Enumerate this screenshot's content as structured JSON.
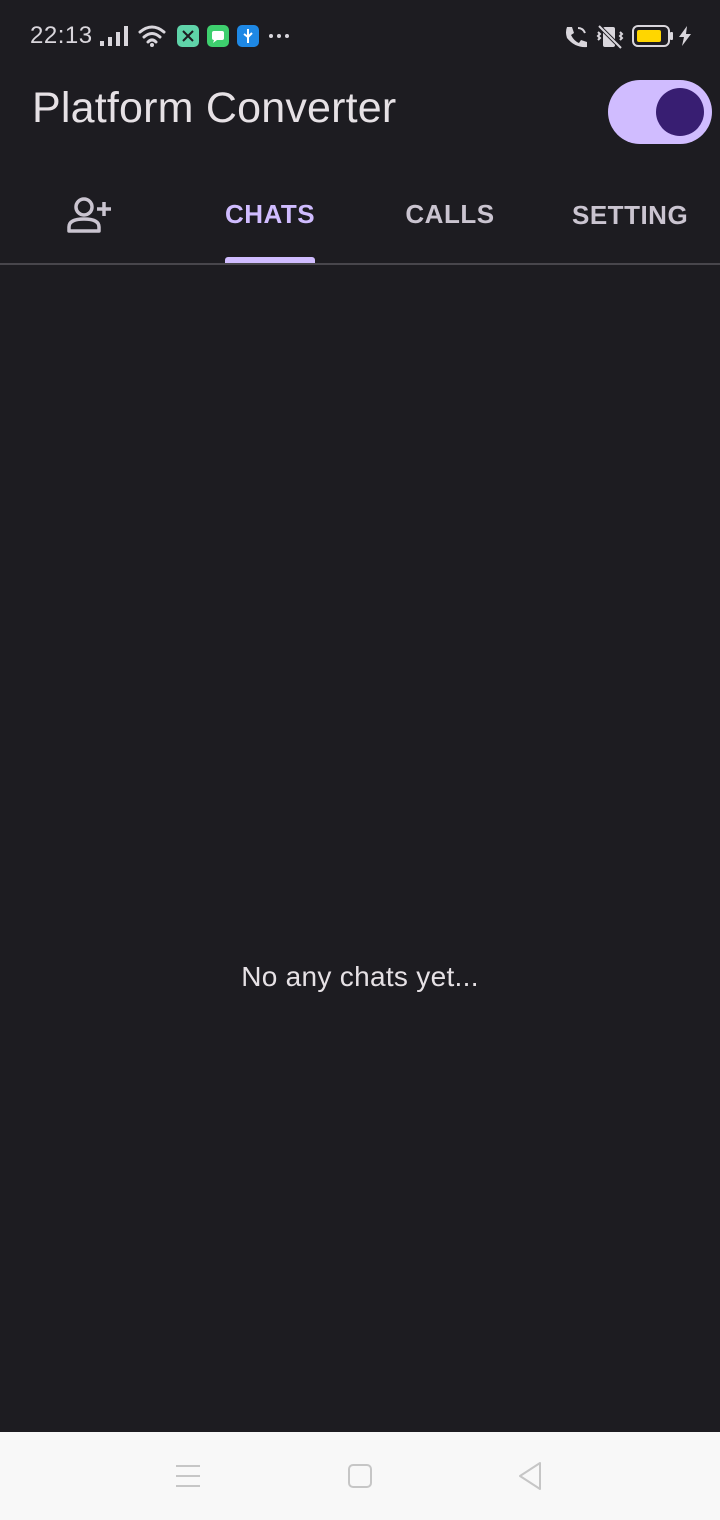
{
  "status_bar": {
    "time": "22:13",
    "icons": [
      "signal-icon",
      "wifi-icon",
      "app-notification-icon",
      "message-icon",
      "usb-icon",
      "more-icon",
      "wifi-calling-icon",
      "vibrate-icon",
      "battery-icon",
      "charging-icon"
    ],
    "battery_color": "#ffd600"
  },
  "app_bar": {
    "title": "Platform Converter",
    "theme_toggle_on": true,
    "accent_color": "#d0bcff"
  },
  "tabs": {
    "items": [
      {
        "icon": "add-person-icon",
        "label": ""
      },
      {
        "label": "CHATS",
        "active": true
      },
      {
        "label": "CALLS",
        "active": false
      },
      {
        "label": "SETTING",
        "active": false
      }
    ]
  },
  "main": {
    "empty_message": "No any chats yet..."
  },
  "nav_bar": {
    "buttons": [
      "menu-icon",
      "home-icon",
      "back-icon"
    ]
  }
}
